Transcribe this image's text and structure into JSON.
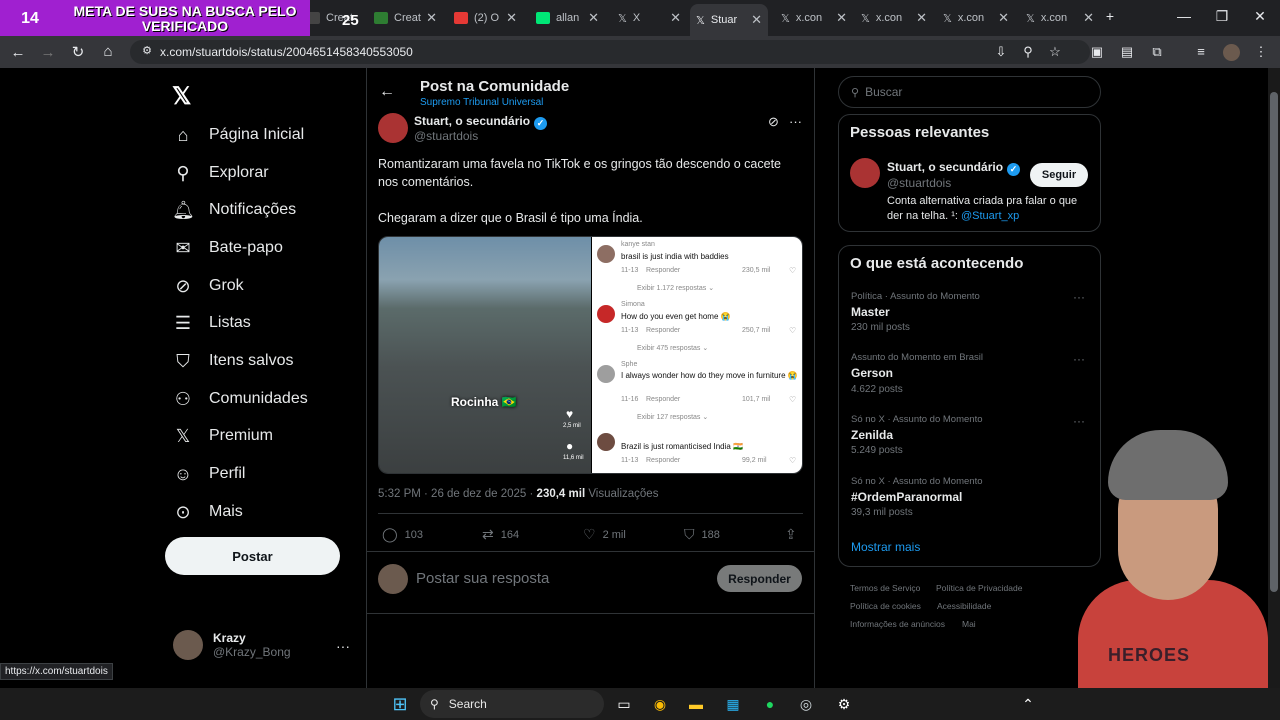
{
  "overlay_banner": {
    "number": "14",
    "text": "META DE SUBS NA BUSCA PELO VERIFICADO",
    "badge": "25"
  },
  "browser": {
    "tabs": [
      {
        "label": "Creat"
      },
      {
        "label": "Creat"
      },
      {
        "label": "(2) O"
      },
      {
        "label": "allan"
      },
      {
        "label": "X"
      },
      {
        "label": "Stuar"
      },
      {
        "label": "x.con"
      },
      {
        "label": "x.con"
      },
      {
        "label": "x.con"
      },
      {
        "label": "x.con"
      }
    ],
    "url": "x.com/stuartdois/status/2004651458340553050",
    "status_url": "https://x.com/stuartdois"
  },
  "sidebar": {
    "items": [
      {
        "label": "Página Inicial",
        "icon": "home-icon"
      },
      {
        "label": "Explorar",
        "icon": "search-icon"
      },
      {
        "label": "Notificações",
        "icon": "bell-icon"
      },
      {
        "label": "Bate-papo",
        "icon": "mail-icon"
      },
      {
        "label": "Grok",
        "icon": "grok-icon"
      },
      {
        "label": "Listas",
        "icon": "list-icon"
      },
      {
        "label": "Itens salvos",
        "icon": "bookmark-icon"
      },
      {
        "label": "Comunidades",
        "icon": "people-icon"
      },
      {
        "label": "Premium",
        "icon": "x-icon"
      },
      {
        "label": "Perfil",
        "icon": "person-icon"
      },
      {
        "label": "Mais",
        "icon": "more-icon"
      }
    ],
    "post_button": "Postar",
    "account": {
      "name": "Krazy",
      "handle": "@Krazy_Bong"
    }
  },
  "post": {
    "header_title": "Post na Comunidade",
    "header_sub": "Supremo Tribunal Universal",
    "author": {
      "name": "Stuart, o secundário",
      "handle": "@stuartdois"
    },
    "text_1": "Romantizaram uma favela no TikTok e os gringos tão descendo o cacete nos comentários.",
    "text_2": "Chegaram a dizer que o Brasil é tipo uma Índia.",
    "media": {
      "left_label": "Rocinha 🇧🇷",
      "side_counts": [
        "2,5 mil",
        "11,6 mil"
      ],
      "comments": [
        {
          "user": "kanye stan",
          "text": "brasil is just india with baddies",
          "date": "11-13",
          "reply": "Responder",
          "likes": "230,5 mil",
          "more": "Exibir 1.172 respostas ⌄"
        },
        {
          "user": "Simona",
          "text": "How do you even get home 😭",
          "date": "11-13",
          "reply": "Responder",
          "likes": "250,7 mil",
          "more": "Exibir 475 respostas ⌄"
        },
        {
          "user": "Sphe",
          "text": "I always wonder how do they move in furniture 😭",
          "date": "11-16",
          "reply": "Responder",
          "likes": "101,7 mil",
          "more": "Exibir 127 respostas ⌄"
        },
        {
          "user": "",
          "text": "Brazil is just romanticised India 🇮🇳",
          "date": "11-13",
          "reply": "Responder",
          "likes": "99,2 mil",
          "more": ""
        }
      ]
    },
    "timestamp": "5:32 PM · 26 de dez de 2025 · ",
    "views": "230,4 mil",
    "views_label": "Visualizações",
    "stats": {
      "replies": "103",
      "reposts": "164",
      "likes": "2 mil",
      "bookmarks": "188"
    },
    "reply_placeholder": "Postar sua resposta",
    "reply_button": "Responder"
  },
  "right": {
    "search_placeholder": "Buscar",
    "relevant_title": "Pessoas relevantes",
    "relevant": {
      "name": "Stuart, o secundário",
      "handle": "@stuartdois",
      "follow": "Seguir",
      "bio": "Conta alternativa criada pra falar o que der na telha. ¹: ",
      "bio_link": "@Stuart_xp"
    },
    "trends_title": "O que está acontecendo",
    "trends": [
      {
        "category": "Política · Assunto do Momento",
        "name": "Master",
        "count": "230 mil posts"
      },
      {
        "category": "Assunto do Momento em Brasil",
        "name": "Gerson",
        "count": "4.622 posts"
      },
      {
        "category": "Só no X · Assunto do Momento",
        "name": "Zenilda",
        "count": "5.249 posts"
      },
      {
        "category": "Só no X · Assunto do Momento",
        "name": "#OrdemParanormal",
        "count": "39,3 mil posts"
      }
    ],
    "show_more": "Mostrar mais",
    "footer": [
      "Termos de Serviço",
      "Política de Privacidade",
      "Política de cookies",
      "Acessibilidade",
      "Informações de anúncios",
      "Mai"
    ]
  },
  "webcam": {
    "shirt_text": "HEROES"
  },
  "taskbar": {
    "search_label": "Search"
  },
  "colors": {
    "accent": "#1d9bf0",
    "banner": "#a020d0",
    "background": "#000000"
  }
}
